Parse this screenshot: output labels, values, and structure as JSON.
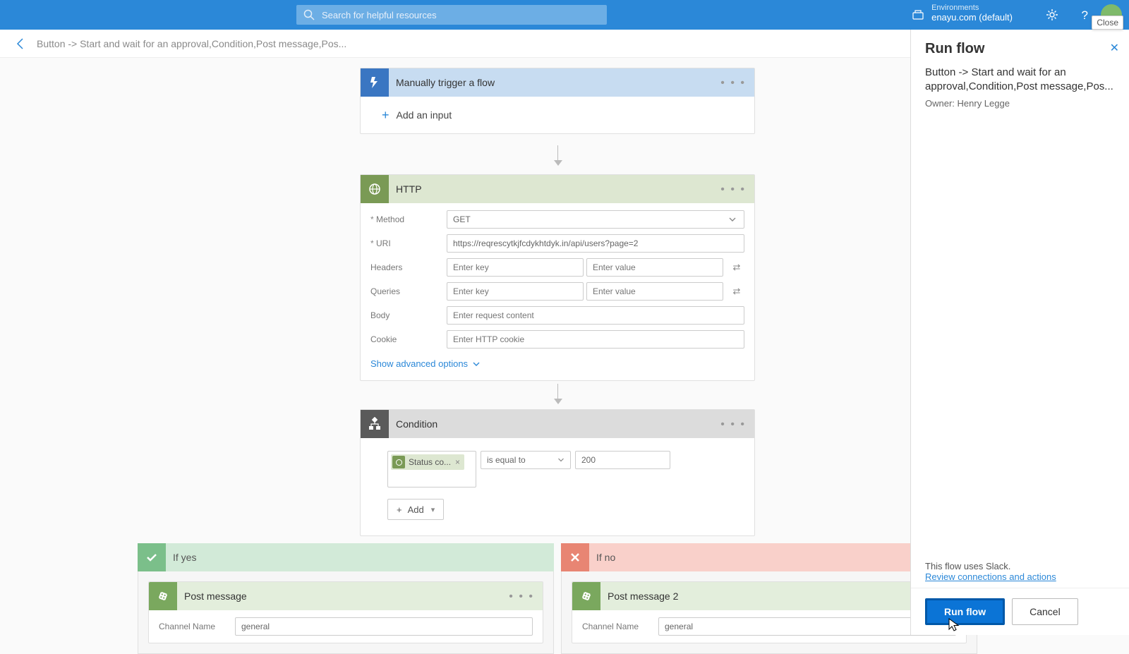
{
  "topbar": {
    "search_placeholder": "Search for helpful resources",
    "env_label": "Environments",
    "env_name": "enayu.com (default)",
    "close_tip": "Close"
  },
  "breadcrumb": {
    "text": "Button -> Start and wait for an approval,Condition,Post message,Pos..."
  },
  "trigger": {
    "title": "Manually trigger a flow",
    "add_input": "Add an input"
  },
  "http": {
    "title": "HTTP",
    "labels": {
      "method": "Method",
      "uri": "URI",
      "headers": "Headers",
      "queries": "Queries",
      "body": "Body",
      "cookie": "Cookie"
    },
    "method_value": "GET",
    "uri_value": "https://reqrescytkjfcdykhtdyk.in/api/users?page=2",
    "headers_key_ph": "Enter key",
    "headers_val_ph": "Enter value",
    "queries_key_ph": "Enter key",
    "queries_val_ph": "Enter value",
    "body_ph": "Enter request content",
    "cookie_ph": "Enter HTTP cookie",
    "advanced": "Show advanced options"
  },
  "condition": {
    "title": "Condition",
    "token_label": "Status co...",
    "operator": "is equal to",
    "value": "200",
    "add_label": "Add"
  },
  "branch": {
    "yes_label": "If yes",
    "no_label": "If no",
    "post1_title": "Post message",
    "post2_title": "Post message 2",
    "channel_label": "Channel Name",
    "channel_value": "general"
  },
  "panel": {
    "title": "Run flow",
    "flow_name": "Button -> Start and wait for an approval,Condition,Post message,Pos...",
    "owner": "Owner: Henry Legge",
    "uses_text": "This flow uses Slack.",
    "review_link": "Review connections and actions",
    "run_btn": "Run flow",
    "cancel_btn": "Cancel"
  }
}
